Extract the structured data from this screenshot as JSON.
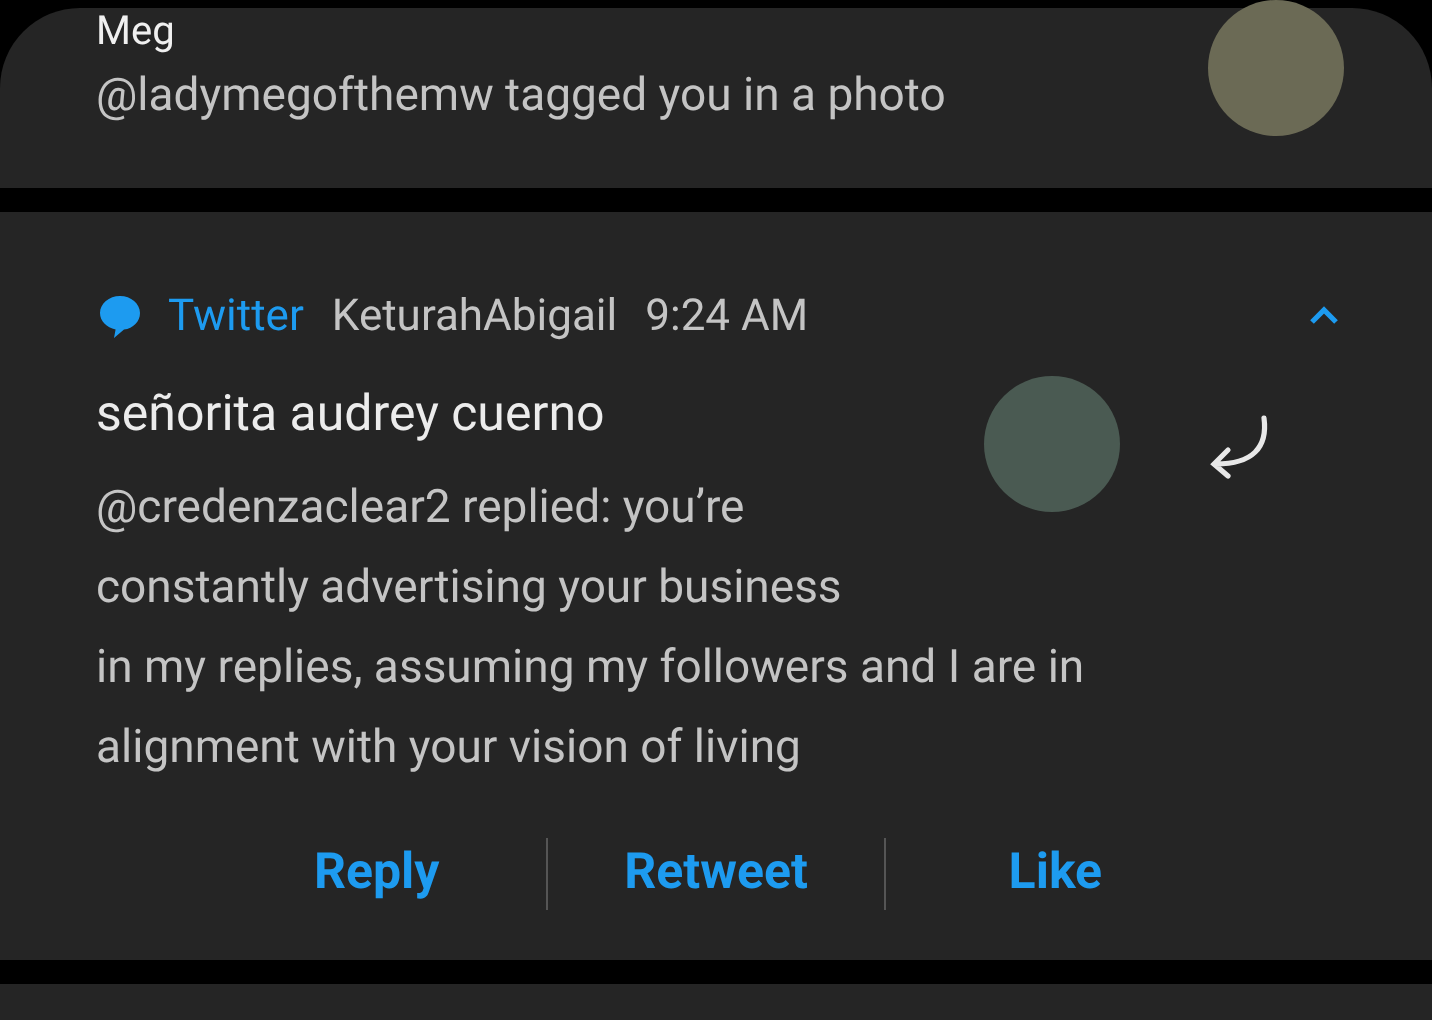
{
  "notifications": [
    {
      "kind": "photo",
      "title": "Meg",
      "text_lines": [
        "@ladymegofthemw tagged you in a photo"
      ]
    },
    {
      "kind": "reply",
      "app": "Twitter",
      "account": "KeturahAbigail",
      "time": "9:24 AM",
      "expanded": true,
      "title": "señorita audrey cuerno",
      "text_lines": [
        "@credenzaclear2 replied: you’re",
        "constantly advertising your business",
        "in my replies, assuming my followers and I are in",
        "alignment with your vision of living"
      ],
      "actions": [
        "Reply",
        "Retweet",
        "Like"
      ]
    }
  ]
}
